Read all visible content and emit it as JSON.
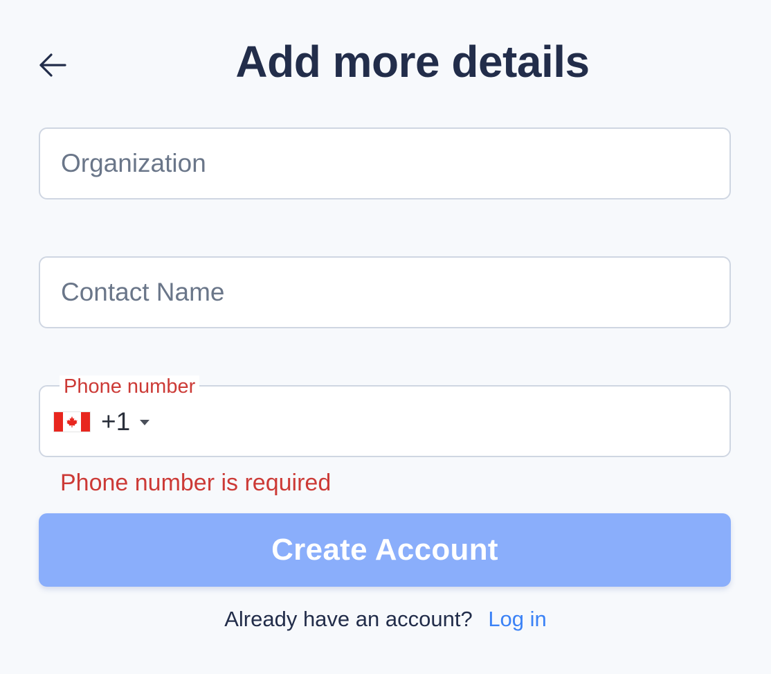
{
  "header": {
    "back_icon": "arrow-left-icon",
    "title": "Add more details"
  },
  "form": {
    "organization": {
      "placeholder": "Organization",
      "value": ""
    },
    "contact_name": {
      "placeholder": "Contact Name",
      "value": ""
    },
    "phone": {
      "label": "Phone number",
      "country_flag": "canada-flag-icon",
      "dial_code": "+1",
      "value": "",
      "error": "Phone number is required"
    },
    "submit_label": "Create Account"
  },
  "footer": {
    "prompt": "Already have an account?",
    "login_label": "Log in"
  },
  "colors": {
    "background": "#f7f9fc",
    "title": "#222d4a",
    "error": "#cc3a36",
    "button": "#8aaefb",
    "link": "#3b82f6"
  }
}
